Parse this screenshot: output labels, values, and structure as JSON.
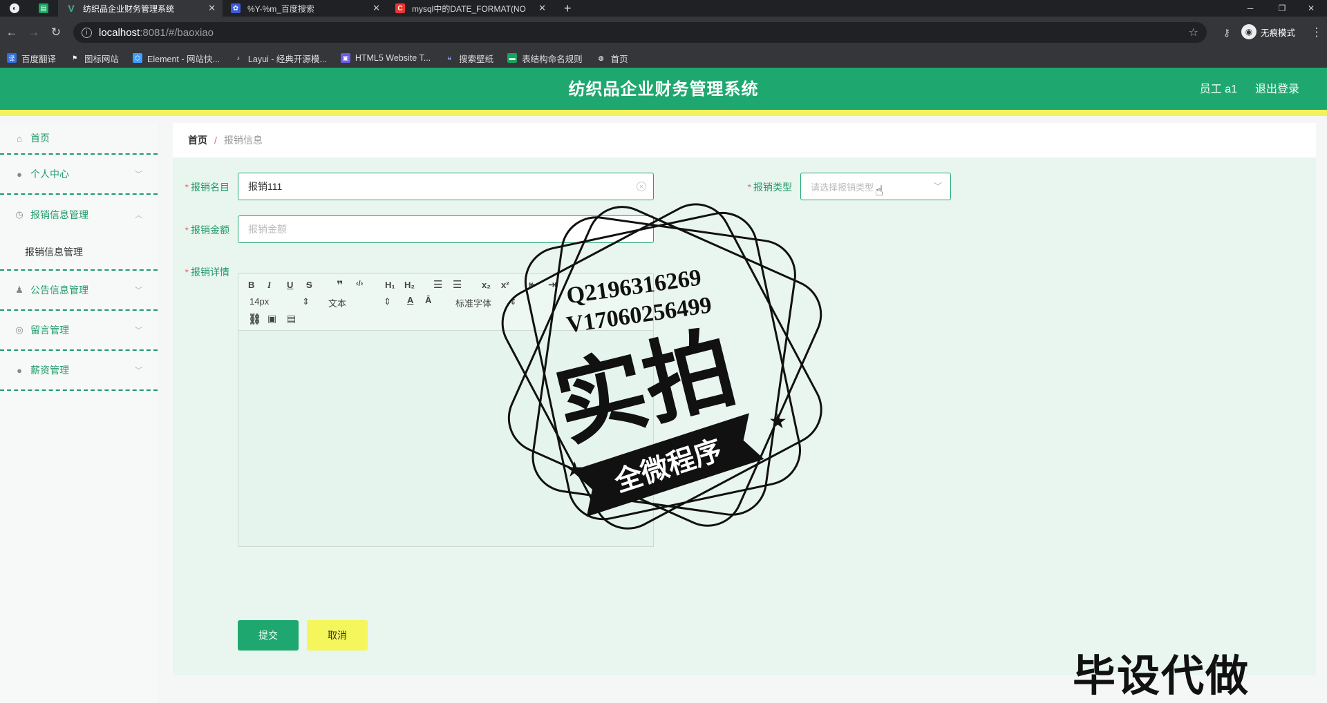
{
  "browser": {
    "tabs": [
      {
        "title": "纺织品企业财务管理系统",
        "icon": "vue-icon",
        "active": true
      },
      {
        "title": "%Y-%m_百度搜索",
        "icon": "baidu-icon",
        "active": false
      },
      {
        "title": "mysql中的DATE_FORMAT(NO",
        "icon": "csdn-icon",
        "active": false
      }
    ],
    "url_host": "localhost",
    "url_path": ":8081/#/baoxiao",
    "profile_label": "无痕模式",
    "bookmarks": [
      "百度翻译",
      "图标网站",
      "Element - 网站快...",
      "Layui - 经典开源模...",
      "HTML5 Website T...",
      "搜索壁纸",
      "表结构命名规则",
      "首页"
    ]
  },
  "header": {
    "title": "纺织品企业财务管理系统",
    "user": "员工 a1",
    "logout": "退出登录"
  },
  "sidebar": {
    "items": [
      {
        "label": "首页",
        "icon": "home-icon"
      },
      {
        "label": "个人中心",
        "icon": "user-icon"
      },
      {
        "label": "报销信息管理",
        "icon": "clock-icon",
        "expanded": true,
        "sub": "报销信息管理"
      },
      {
        "label": "公告信息管理",
        "icon": "person-icon"
      },
      {
        "label": "留言管理",
        "icon": "globe-icon"
      },
      {
        "label": "薪资管理",
        "icon": "location-icon"
      }
    ]
  },
  "breadcrumb": {
    "home": "首页",
    "sep": "/",
    "current": "报销信息"
  },
  "form": {
    "name_label": "报销名目",
    "name_value": "报销111",
    "type_label": "报销类型",
    "type_placeholder": "请选择报销类型",
    "amount_label": "报销金额",
    "amount_placeholder": "报销金额",
    "detail_label": "报销详情",
    "editor": {
      "font_size": "14px",
      "text_style": "文本",
      "font_family": "标准字体"
    },
    "submit": "提交",
    "cancel": "取消"
  },
  "watermark": {
    "qq": "Q2196316269",
    "wechat": "V17060256499",
    "main": "实拍",
    "ribbon": "全微程序",
    "corner": "毕设代做"
  },
  "colors": {
    "primary": "#1ea86f",
    "accent": "#f2f25c",
    "required": "#f56c6c"
  }
}
